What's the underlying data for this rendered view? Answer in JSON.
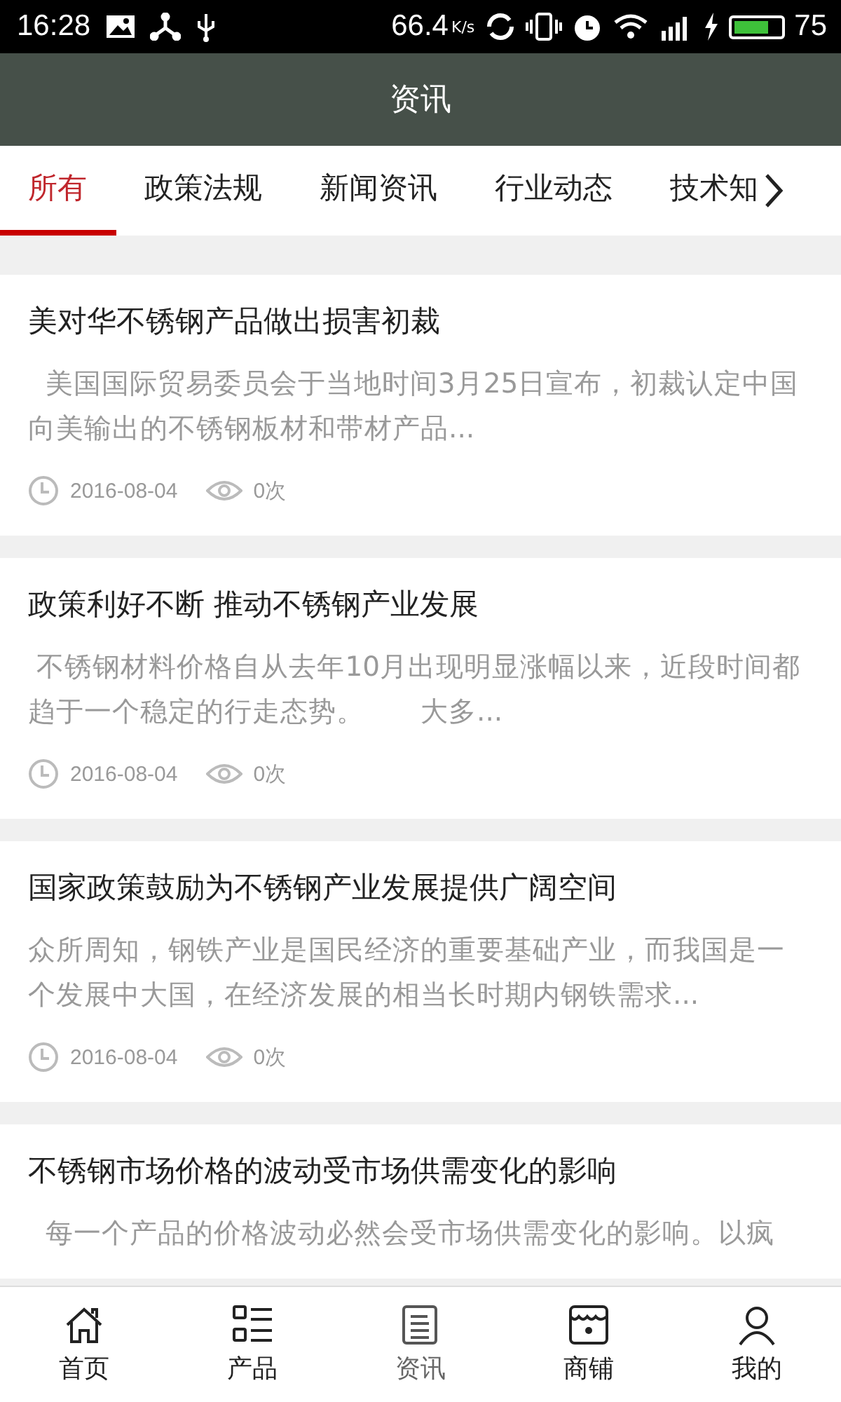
{
  "status_bar": {
    "time": "16:28",
    "speed": "66.4",
    "speed_unit": "K/s",
    "battery": "75"
  },
  "header": {
    "title": "资讯"
  },
  "tabs": [
    {
      "label": "所有",
      "selected": true
    },
    {
      "label": "政策法规",
      "selected": false
    },
    {
      "label": "新闻资讯",
      "selected": false
    },
    {
      "label": "行业动态",
      "selected": false
    },
    {
      "label": "技术知",
      "selected": false
    }
  ],
  "articles": [
    {
      "title": "美对华不锈钢产品做出损害初裁",
      "summary": "  美国国际贸易委员会于当地时间3月25日宣布，初裁认定中国向美输出的不锈钢板材和带材产品...",
      "date": "2016-08-04",
      "views": "0次"
    },
    {
      "title": "政策利好不断 推动不锈钢产业发展",
      "summary": " 不锈钢材料价格自从去年10月出现明显涨幅以来，近段时间都趋于一个稳定的行走态势。　　大多...",
      "date": "2016-08-04",
      "views": "0次"
    },
    {
      "title": "国家政策鼓励为不锈钢产业发展提供广阔空间",
      "summary": "众所周知，钢铁产业是国民经济的重要基础产业，而我国是一个发展中大国，在经济发展的相当长时期内钢铁需求...",
      "date": "2016-08-04",
      "views": "0次"
    },
    {
      "title": "不锈钢市场价格的波动受市场供需变化的影响",
      "summary": "  每一个产品的价格波动必然会受市场供需变化的影响。以疯"
    }
  ],
  "bottom_nav": [
    {
      "label": "首页",
      "kind": "home",
      "selected": false
    },
    {
      "label": "产品",
      "kind": "list",
      "selected": false
    },
    {
      "label": "资讯",
      "kind": "news",
      "selected": true
    },
    {
      "label": "商铺",
      "kind": "shop",
      "selected": false
    },
    {
      "label": "我的",
      "kind": "user",
      "selected": false
    }
  ]
}
